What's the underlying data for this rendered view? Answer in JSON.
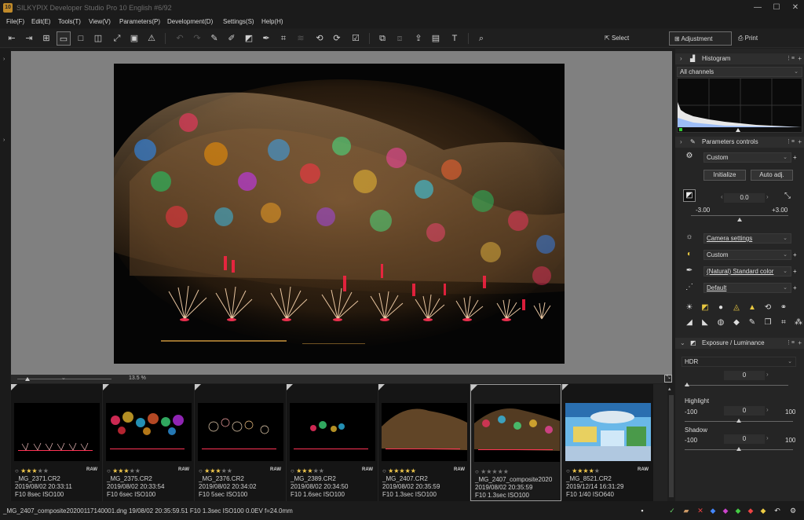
{
  "window": {
    "title": "SILKYPIX Developer Studio Pro 10 English  #6/92",
    "app_icon_text": "10",
    "minimize": "—",
    "maximize": "☐",
    "close": "✕"
  },
  "menu": [
    "File(F)",
    "Edit(E)",
    "Tools(T)",
    "View(V)",
    "Parameters(P)",
    "Development(D)",
    "Settings(S)",
    "Help(H)"
  ],
  "toolbar": {
    "modes": {
      "select": "Select",
      "adjustment": "Adjustment",
      "print": "Print"
    }
  },
  "zoom": {
    "value": "13.5",
    "unit": "%"
  },
  "thumbnails": [
    {
      "name": "_MG_2371.CR2",
      "datetime": "2019/08/02 20:33:11",
      "exposure": "F10 8sec ISO100",
      "rating": 3,
      "raw": "RAW",
      "selected": false
    },
    {
      "name": "_MG_2375.CR2",
      "datetime": "2019/08/02 20:33:54",
      "exposure": "F10 6sec ISO100",
      "rating": 3,
      "raw": "RAW",
      "selected": false
    },
    {
      "name": "_MG_2376.CR2",
      "datetime": "2019/08/02 20:34:02",
      "exposure": "F10 5sec ISO100",
      "rating": 3,
      "raw": "RAW",
      "selected": false
    },
    {
      "name": "_MG_2389.CR2",
      "datetime": "2019/08/02 20:34:50",
      "exposure": "F10 1.6sec ISO100",
      "rating": 3,
      "raw": "RAW",
      "selected": false
    },
    {
      "name": "_MG_2407.CR2",
      "datetime": "2019/08/02 20:35:59",
      "exposure": "F10 1.3sec ISO100",
      "rating": 5,
      "raw": "RAW",
      "selected": false
    },
    {
      "name": "_MG_2407_composite2020",
      "datetime": "2019/08/02 20:35:59",
      "exposure": "F10 1.3sec ISO100",
      "rating": 0,
      "raw": "",
      "selected": true
    },
    {
      "name": "_MG_8521.CR2",
      "datetime": "2019/12/14 16:31:29",
      "exposure": "F10 1/40 ISO640",
      "rating": 4,
      "raw": "RAW",
      "selected": false
    }
  ],
  "panel": {
    "histogram": {
      "title": "Histogram",
      "channel": "All channels"
    },
    "params": {
      "title": "Parameters controls",
      "preset": "Custom",
      "initialize": "Initialize",
      "auto_adj": "Auto adj.",
      "exposure_value": "0.0",
      "exposure_min": "-3.00",
      "exposure_max": "+3.00",
      "white_balance": "Camera settings",
      "tone": "Custom",
      "color": "(Natural) Standard color",
      "sharpness": "Default"
    },
    "exposure": {
      "title": "Exposure / Luminance",
      "mode": "HDR",
      "hdr_value": "0",
      "highlight_label": "Highlight",
      "highlight_min": "-100",
      "highlight_value": "0",
      "highlight_max": "100",
      "shadow_label": "Shadow",
      "shadow_min": "-100",
      "shadow_value": "0",
      "shadow_max": "100"
    }
  },
  "status": {
    "text": "_MG_2407_composite20200117140001.dng 19/08/02 20:35:59.51 F10 1.3sec ISO100  0.0EV f=24.0mm"
  },
  "colors": {
    "star": "#f2c94c",
    "background": "#1e1e1e",
    "panel": "#252525"
  }
}
